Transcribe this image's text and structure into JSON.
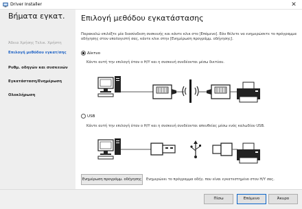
{
  "window": {
    "title": "Driver Installer",
    "close_glyph": "✕"
  },
  "sidebar": {
    "title": "Βήματα εγκατ.",
    "items": [
      {
        "label": "Άδεια Χρήσης Τελικ. Χρήστη",
        "state": "done"
      },
      {
        "label": "Επιλογή μεθόδου εγκατ/σης",
        "state": "active"
      },
      {
        "label": "Ρυθμ. οδηγών και συσκευών",
        "state": "pending"
      },
      {
        "label": "Εγκατάσταση/Ενημέρωση",
        "state": "pending"
      },
      {
        "label": "Ολοκλήρωση",
        "state": "pending"
      }
    ]
  },
  "main": {
    "title": "Επιλογή μεθόδου εγκατάστασης",
    "intro": "Παρακαλώ επιλέξτε μία διασύνδεση συσκευής και κάντε κλικ στο [Επόμενο]. Εάν θέλετε να ενημερώσετε το πρόγραμμα οδήγησης στον υπολογιστή σας, κάντε κλικ στην [Ενημέρωση προγράμμ. οδήγησης].",
    "options": [
      {
        "label": "Δίκτυο",
        "selected": true,
        "description": "Κάντε αυτή την επιλογή όταν ο Η/Υ και η συσκευή συνδέονται μέσω δικτύου."
      },
      {
        "label": "USB",
        "selected": false,
        "description": "Κάντε αυτή την επιλογή όταν ο Η/Υ και η συσκευή συνδέονται απευθείας μέσω ενός καλωδίου USB."
      }
    ],
    "update_button": "Ενημέρωση προγράμμ. οδήγησης",
    "update_note": "Ενημερώνει το πρόγραμμα οδήγ. που είναι εγκατεστημένο στον Η/Υ σας."
  },
  "footer": {
    "back": "Πίσω",
    "next": "Επόμενο",
    "cancel": "Άκυρο"
  },
  "colors": {
    "accent": "#1f63c6",
    "sidebar_bg": "#eeeeee",
    "footer_bg": "#f0f0f0"
  }
}
